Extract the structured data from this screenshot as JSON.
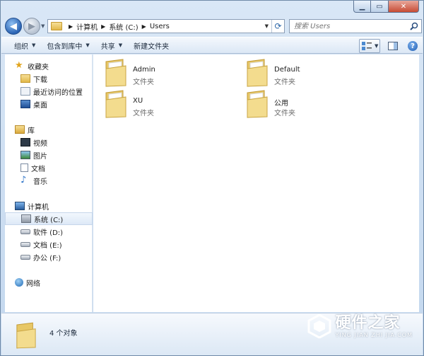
{
  "address": {
    "crumbs": [
      "计算机",
      "系统 (C:)",
      "Users"
    ]
  },
  "search": {
    "placeholder": "搜索 Users"
  },
  "toolbar": {
    "organize": "组织",
    "include_library": "包含到库中",
    "share": "共享",
    "new_folder": "新建文件夹"
  },
  "nav": {
    "favorites": "收藏夹",
    "downloads": "下载",
    "recent_places": "最近访问的位置",
    "desktop": "桌面",
    "libraries": "库",
    "videos": "视频",
    "pictures": "图片",
    "documents": "文档",
    "music": "音乐",
    "computer": "计算机",
    "drive_c": "系统 (C:)",
    "drive_d": "软件 (D:)",
    "drive_e": "文档 (E:)",
    "drive_f": "办公 (F:)",
    "network": "网络"
  },
  "items": [
    {
      "name": "Admin",
      "type": "文件夹"
    },
    {
      "name": "Default",
      "type": "文件夹"
    },
    {
      "name": "XU",
      "type": "文件夹"
    },
    {
      "name": "公用",
      "type": "文件夹"
    }
  ],
  "details": {
    "count": "4 个对象"
  },
  "watermark": {
    "title": "硬件之家",
    "subtitle": "YING JIAN ZHI JIA.COM"
  }
}
